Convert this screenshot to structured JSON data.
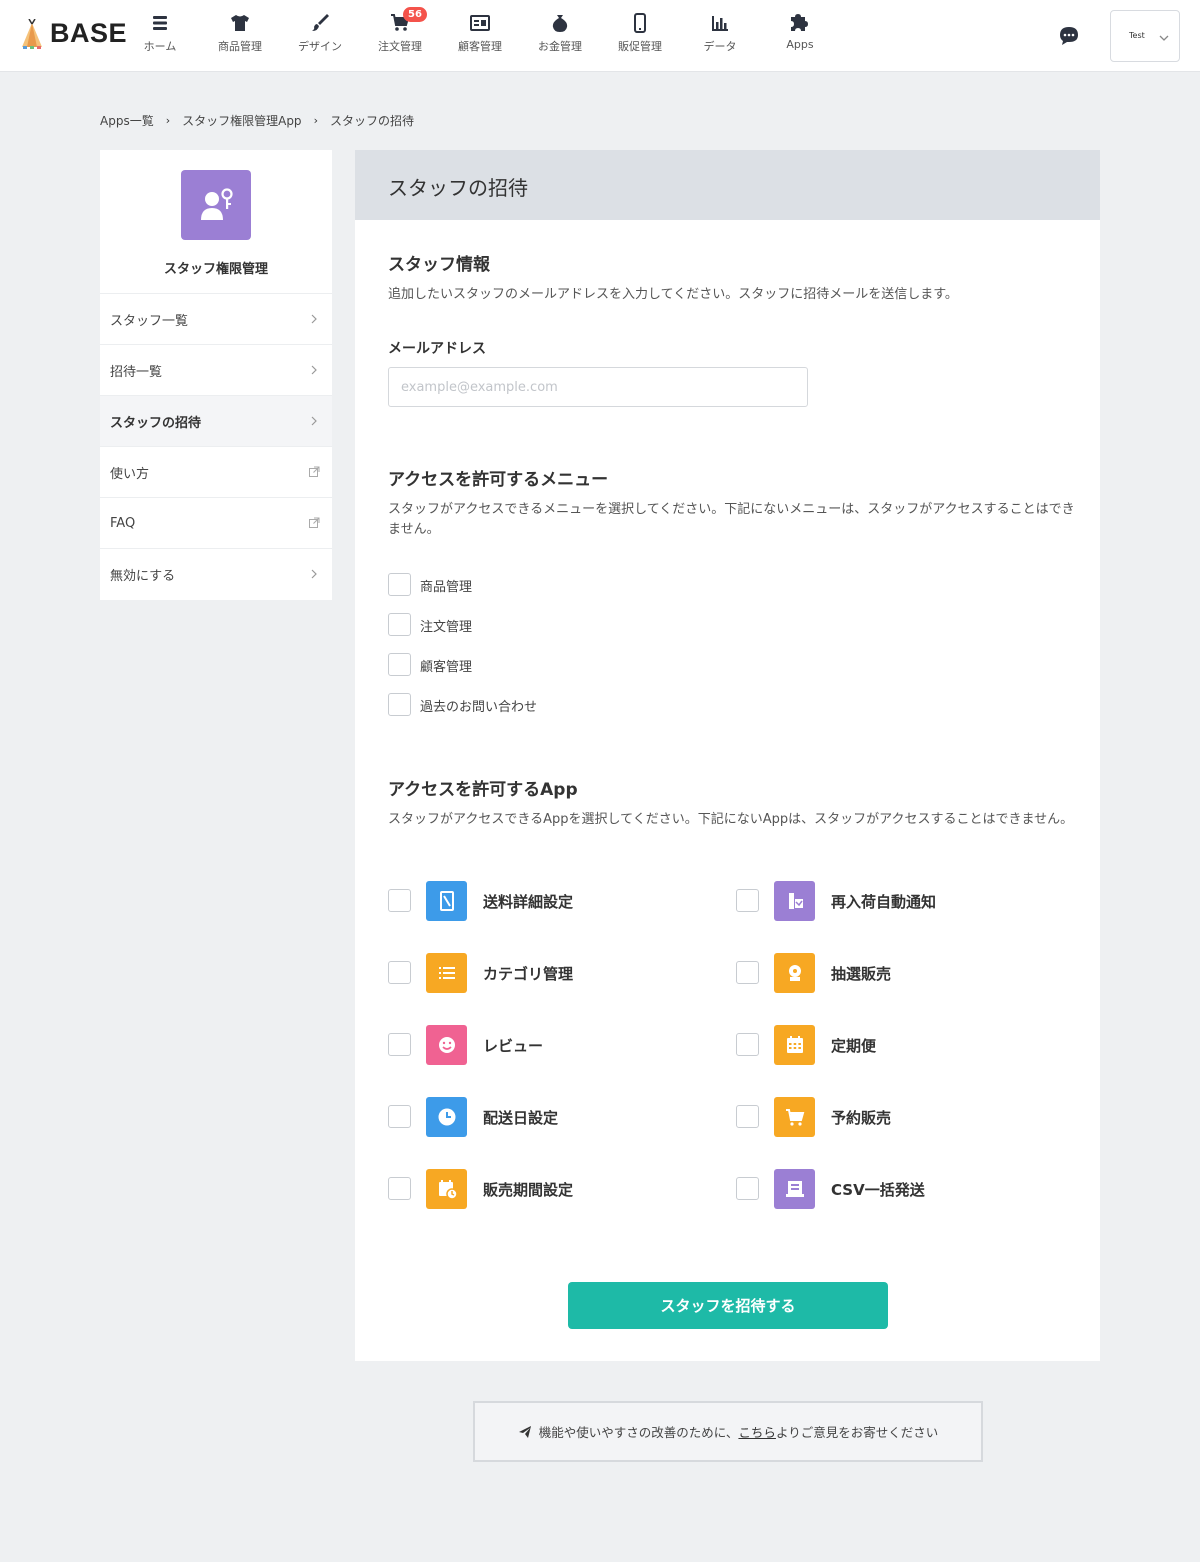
{
  "brand": {
    "name": "BASE"
  },
  "nav": [
    {
      "label": "ホーム",
      "icon": "home-list-icon"
    },
    {
      "label": "商品管理",
      "icon": "tshirt-icon"
    },
    {
      "label": "デザイン",
      "icon": "brush-icon"
    },
    {
      "label": "注文管理",
      "icon": "cart-icon",
      "badge": "56"
    },
    {
      "label": "顧客管理",
      "icon": "customer-card-icon"
    },
    {
      "label": "お金管理",
      "icon": "money-bag-icon"
    },
    {
      "label": "販促管理",
      "icon": "smartphone-icon"
    },
    {
      "label": "データ",
      "icon": "bar-chart-icon"
    },
    {
      "label": "Apps",
      "icon": "puzzle-icon"
    }
  ],
  "account": {
    "name": "Test"
  },
  "breadcrumb": [
    "Apps一覧",
    "スタッフ権限管理App",
    "スタッフの招待"
  ],
  "sidebar": {
    "title": "スタッフ権限管理",
    "items": [
      {
        "label": "スタッフ一覧",
        "icon": "chevron-right-icon"
      },
      {
        "label": "招待一覧",
        "icon": "chevron-right-icon"
      },
      {
        "label": "スタッフの招待",
        "icon": "chevron-right-icon",
        "active": true
      },
      {
        "label": "使い方",
        "icon": "external-link-icon"
      },
      {
        "label": "FAQ",
        "icon": "external-link-icon"
      },
      {
        "label": "無効にする",
        "icon": "chevron-right-icon"
      }
    ]
  },
  "main": {
    "title": "スタッフの招待",
    "staff_info": {
      "title": "スタッフ情報",
      "description": "追加したいスタッフのメールアドレスを入力してください。スタッフに招待メールを送信します。",
      "email_label": "メールアドレス",
      "email_placeholder": "example@example.com",
      "email_value": ""
    },
    "menus": {
      "title": "アクセスを許可するメニュー",
      "description": "スタッフがアクセスできるメニューを選択してください。下記にないメニューは、スタッフがアクセスすることはできません。",
      "items": [
        "商品管理",
        "注文管理",
        "顧客管理",
        "過去のお問い合わせ"
      ]
    },
    "apps": {
      "title": "アクセスを許可するApp",
      "description": "スタッフがアクセスできるAppを選択してください。下記にないAppは、スタッフがアクセスすることはできません。",
      "items": [
        {
          "name": "送料詳細設定",
          "color": "#3d9be9",
          "icon": "shipping-icon"
        },
        {
          "name": "再入荷自動通知",
          "color": "#9b7fd4",
          "icon": "restock-icon"
        },
        {
          "name": "カテゴリ管理",
          "color": "#f7a823",
          "icon": "list-icon"
        },
        {
          "name": "抽選販売",
          "color": "#f7a823",
          "icon": "lottery-icon"
        },
        {
          "name": "レビュー",
          "color": "#f06292",
          "icon": "smile-icon"
        },
        {
          "name": "定期便",
          "color": "#f7a823",
          "icon": "calendar-icon"
        },
        {
          "name": "配送日設定",
          "color": "#3d9be9",
          "icon": "clock-icon"
        },
        {
          "name": "予約販売",
          "color": "#f7a823",
          "icon": "reserve-cart-icon"
        },
        {
          "name": "販売期間設定",
          "color": "#f7a823",
          "icon": "period-calendar-icon"
        },
        {
          "name": "CSV一括発送",
          "color": "#9b7fd4",
          "icon": "truck-icon"
        }
      ]
    },
    "submit_label": "スタッフを招待する"
  },
  "feedback": {
    "before": "機能や使いやすさの改善のために、",
    "link": "こちら",
    "after": "よりご意見をお寄せください"
  },
  "colors": {
    "accent": "#1ebaa7",
    "badge": "#f4534b",
    "header_bg": "#dce0e5"
  }
}
